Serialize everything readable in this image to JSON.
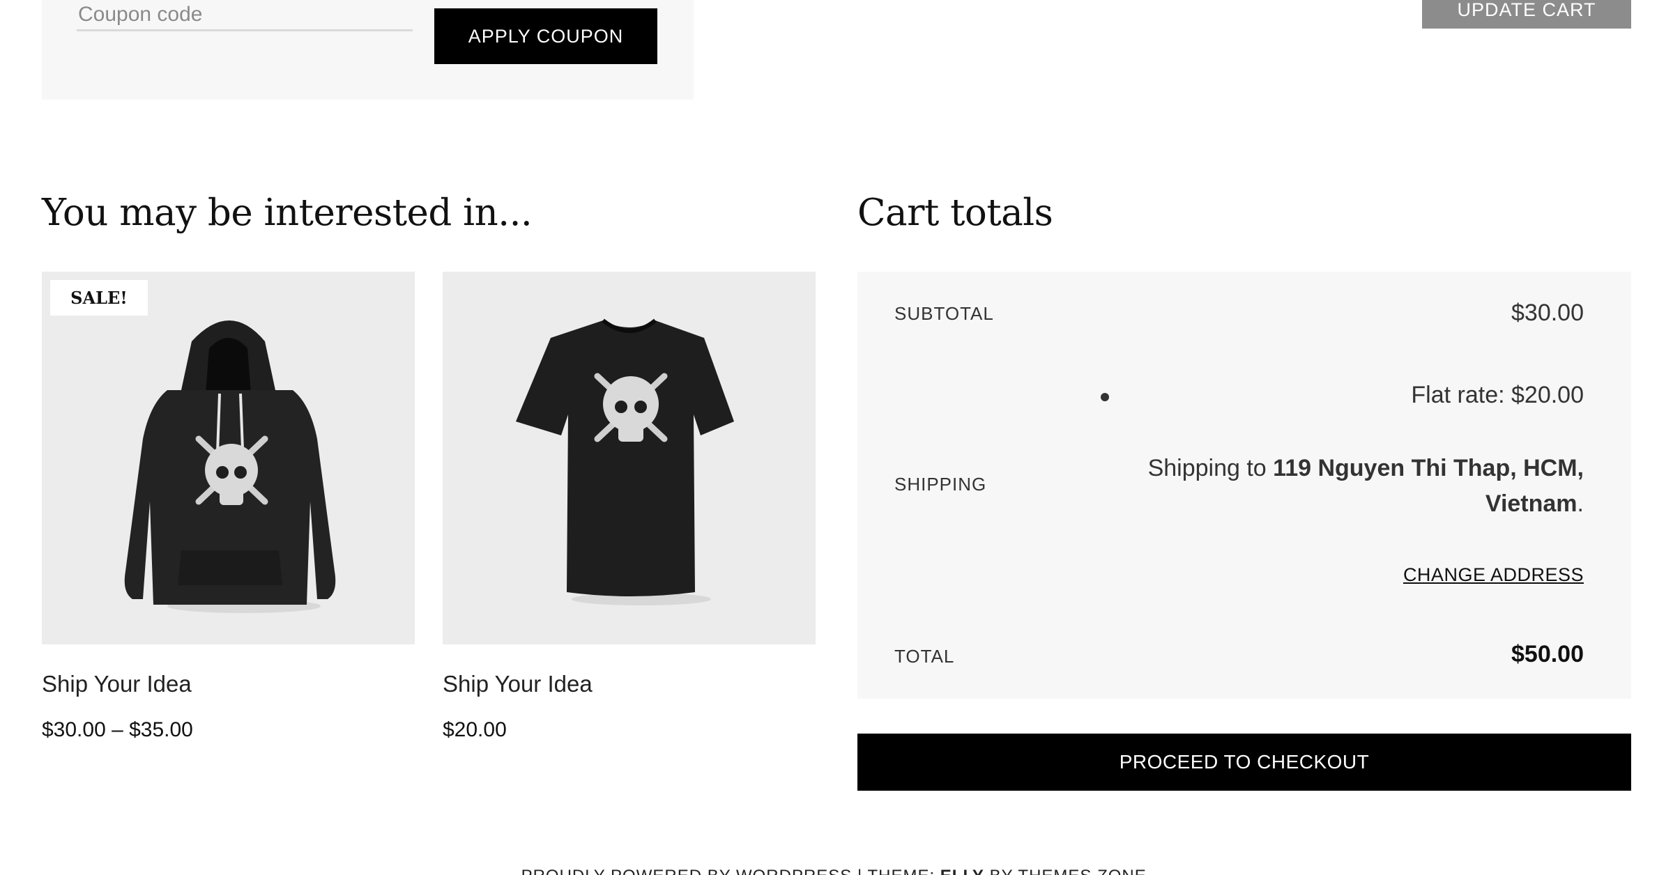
{
  "coupon": {
    "placeholder": "Coupon code",
    "apply_label": "APPLY COUPON"
  },
  "update_cart_label": "UPDATE CART",
  "interest": {
    "title": "You may be interested in...",
    "products": [
      {
        "name": "Ship Your Idea",
        "price": "$30.00 – $35.00",
        "badge": "SALE!",
        "image_icon": "hoodie-icon"
      },
      {
        "name": "Ship Your Idea",
        "price": "$20.00",
        "image_icon": "tshirt-icon"
      }
    ]
  },
  "totals": {
    "title": "Cart totals",
    "subtotal_label": "SUBTOTAL",
    "subtotal_value": "$30.00",
    "shipping_label": "SHIPPING",
    "flat_rate": "Flat rate: $20.00",
    "shipping_to_prefix": "Shipping to ",
    "shipping_address": "119 Nguyen Thi Thap, HCM, Vietnam",
    "shipping_to_suffix": ".",
    "change_address": "CHANGE ADDRESS",
    "total_label": "TOTAL",
    "total_value": "$50.00"
  },
  "checkout_label": "PROCEED TO CHECKOUT",
  "footer": {
    "prefix": "PROUDLY POWERED BY WORDPRESS | THEME: ",
    "theme": "ELLY",
    "suffix": " BY THEMES ZONE."
  },
  "colors": {
    "button_primary": "#000000",
    "button_update": "#8c8c8c",
    "panel_bg": "#f7f7f7",
    "product_bg": "#ececec"
  }
}
